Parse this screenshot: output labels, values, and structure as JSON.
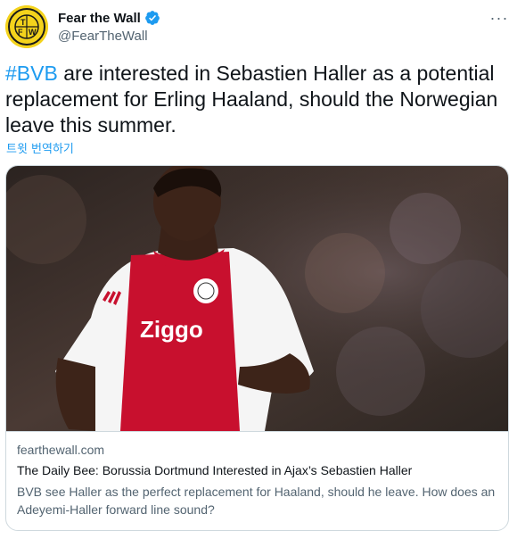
{
  "account": {
    "display_name": "Fear the Wall",
    "handle": "@FearTheWall",
    "avatar_text": "FTW",
    "verified_icon": "verified-badge-icon"
  },
  "tweet": {
    "hashtag": "#BVB",
    "body": " are interested in Sebastien Haller as a potential replacement for Erling Haaland, should the Norwegian leave this summer.",
    "translate_label": "트윗 번역하기"
  },
  "card": {
    "image_alt": "Sebastien Haller in Ajax shirt",
    "domain": "fearthewall.com",
    "title": "The Daily Bee: Borussia Dortmund Interested in Ajax’s Sebastien Haller",
    "description": "BVB see Haller as the perfect replacement for Haaland, should he leave. How does an Adeyemi-Haller forward line sound?",
    "shirt_sponsor": "Ziggo"
  },
  "colors": {
    "accent": "#1d9bf0",
    "text_primary": "#0f1419",
    "text_secondary": "#536471",
    "avatar_bg": "#f4d31c",
    "shirt_red": "#c8102e"
  }
}
